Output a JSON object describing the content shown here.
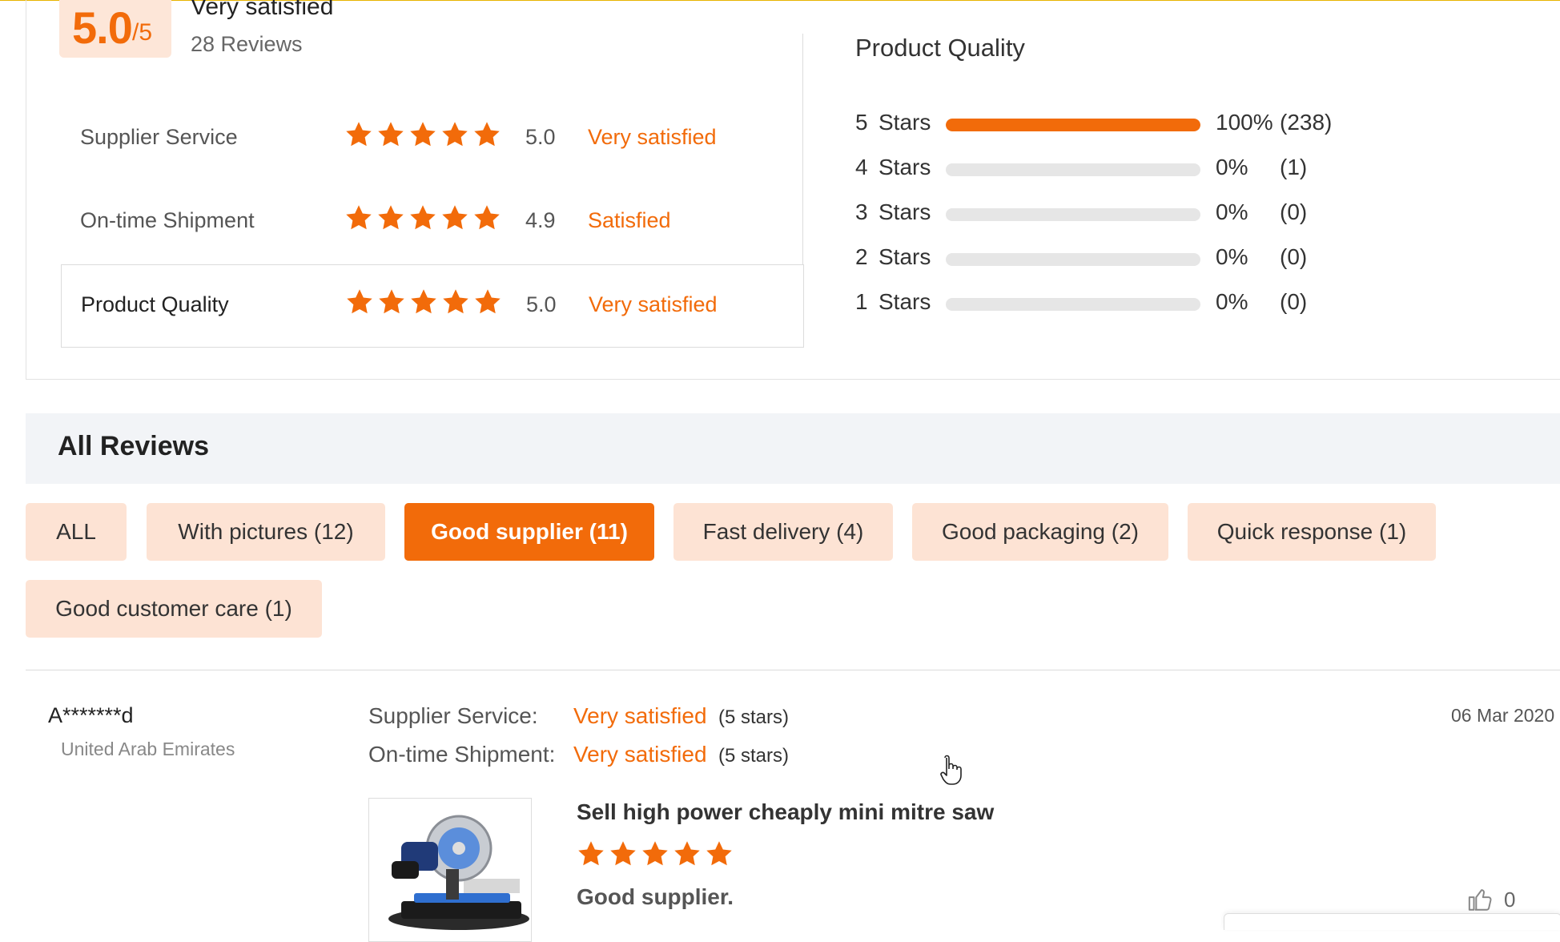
{
  "colors": {
    "accent": "#f26b0a",
    "tag_bg": "#fde3d4",
    "bar_track": "#e6e6e6"
  },
  "summary": {
    "score": "5.0",
    "score_of": "/5",
    "title": "Very satisfied",
    "reviews_count": "28 Reviews",
    "ratings": [
      {
        "label": "Supplier Service",
        "stars": 5,
        "score": "5.0",
        "word": "Very satisfied"
      },
      {
        "label": "On-time Shipment",
        "stars": 5,
        "score": "4.9",
        "word": "Satisfied"
      },
      {
        "label": "Product Quality",
        "stars": 5,
        "score": "5.0",
        "word": "Very satisfied"
      }
    ]
  },
  "product_quality": {
    "title": "Product Quality",
    "rows": [
      {
        "num": "5",
        "label": "Stars",
        "fill": 1.0,
        "pct": "100%",
        "count": "(238)"
      },
      {
        "num": "4",
        "label": "Stars",
        "fill": 0.0,
        "pct": "0%",
        "count": "(1)"
      },
      {
        "num": "3",
        "label": "Stars",
        "fill": 0.0,
        "pct": "0%",
        "count": "(0)"
      },
      {
        "num": "2",
        "label": "Stars",
        "fill": 0.0,
        "pct": "0%",
        "count": "(0)"
      },
      {
        "num": "1",
        "label": "Stars",
        "fill": 0.0,
        "pct": "0%",
        "count": "(0)"
      }
    ]
  },
  "all_reviews": {
    "title": "All Reviews",
    "tags": [
      {
        "label": "ALL",
        "active": false
      },
      {
        "label": "With pictures (12)",
        "active": false
      },
      {
        "label": "Good supplier (11)",
        "active": true
      },
      {
        "label": "Fast delivery (4)",
        "active": false
      },
      {
        "label": "Good packaging (2)",
        "active": false
      },
      {
        "label": "Quick response (1)",
        "active": false
      },
      {
        "label": "Good customer care (1)",
        "active": false
      }
    ]
  },
  "review": {
    "name": "A*******d",
    "country": "United Arab Emirates",
    "date": "06 Mar 2020",
    "supplier_service_key": "Supplier Service:",
    "supplier_service_value": "Very satisfied",
    "supplier_service_stars": "(5 stars)",
    "shipment_key": "On-time Shipment:",
    "shipment_value": "Very satisfied",
    "shipment_stars": "(5 stars)",
    "product_title": "Sell high power cheaply mini mitre saw",
    "product_stars": 5,
    "text": "Good supplier.",
    "likes": "0"
  },
  "icons": {
    "star": "star-icon",
    "like": "thumbs-up-icon",
    "cursor": "hand-cursor-icon"
  }
}
